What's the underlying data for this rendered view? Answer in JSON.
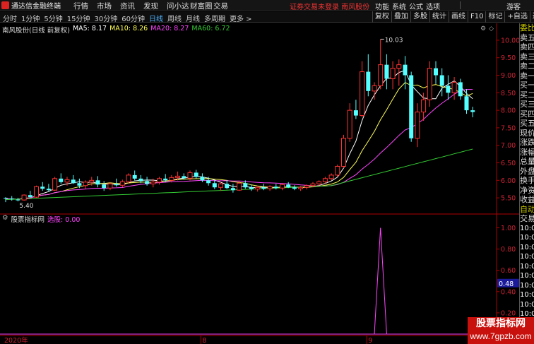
{
  "menubar": {
    "app_title": "通达信金融终端",
    "items": [
      "行情",
      "市场",
      "资讯",
      "发现",
      "问小达",
      "财富圈",
      "交易"
    ],
    "notice": "证券交易未登录  南风股份",
    "right_items": [
      "功能",
      "系统",
      "公式",
      "选项"
    ],
    "guest": "游客"
  },
  "toolbar": {
    "periods": [
      "分时",
      "1分钟",
      "5分钟",
      "15分钟",
      "30分钟",
      "60分钟",
      "日线",
      "周线",
      "月线",
      "多周期",
      "更多 >"
    ],
    "active_period": "日线",
    "tools": [
      "复权",
      "叠加",
      "多股",
      "统计",
      "画线",
      "F10",
      "标记",
      "+自选",
      "返回"
    ]
  },
  "main_panel": {
    "stock_title": "南风股份(日线 前复权)",
    "ma5": "MA5: 8.17",
    "ma10": "MA10: 8.26",
    "ma20": "MA20: 8.27",
    "ma60": "MA60: 6.72",
    "high_label": "10.03",
    "low_label": "5.40"
  },
  "sub_panel": {
    "title": "股票指标网",
    "value_label": "选股: 0.00",
    "cursor_value": "0.48"
  },
  "x_axis": {
    "labels": [
      "2020年",
      "8",
      "9"
    ]
  },
  "colors": {
    "up": "#ff3333",
    "down": "#54ffff",
    "ma5": "#ffffff",
    "ma10": "#ffff55",
    "ma20": "#ff44ff",
    "ma60": "#33cc33",
    "indicator": "#ff44ff",
    "axis": "#b00000",
    "grid": "#4a0000"
  },
  "chart_data": [
    {
      "type": "candlestick",
      "title": "南风股份(日线 前复权)",
      "ylim": [
        5.2,
        10.2
      ],
      "yticks": [
        5.5,
        6.0,
        6.5,
        7.0,
        7.5,
        8.0,
        8.5,
        9.0,
        9.5,
        10.0
      ],
      "ytick_labels": [
        "5.50",
        "6.00",
        "6.50",
        "7.00",
        "7.50",
        "8.00",
        "8.50",
        "9.00",
        "9.50",
        "10.00"
      ],
      "candles": [
        [
          5.5,
          5.52,
          5.38,
          5.48
        ],
        [
          5.48,
          5.55,
          5.42,
          5.46
        ],
        [
          5.45,
          5.5,
          5.4,
          5.44
        ],
        [
          5.44,
          5.6,
          5.42,
          5.58
        ],
        [
          5.58,
          5.7,
          5.5,
          5.52
        ],
        [
          5.52,
          5.85,
          5.5,
          5.82
        ],
        [
          5.82,
          5.95,
          5.7,
          5.76
        ],
        [
          5.76,
          5.9,
          5.68,
          5.72
        ],
        [
          5.72,
          6.1,
          5.7,
          6.05
        ],
        [
          6.05,
          6.2,
          5.9,
          5.95
        ],
        [
          5.95,
          6.1,
          5.85,
          6.02
        ],
        [
          6.02,
          6.15,
          5.9,
          5.92
        ],
        [
          5.92,
          6.05,
          5.78,
          5.85
        ],
        [
          5.85,
          6.0,
          5.75,
          5.95
        ],
        [
          5.95,
          6.1,
          5.85,
          6.0
        ],
        [
          6.0,
          6.12,
          5.8,
          5.88
        ],
        [
          5.88,
          5.98,
          5.7,
          5.78
        ],
        [
          5.78,
          5.95,
          5.72,
          5.9
        ],
        [
          5.9,
          6.05,
          5.82,
          5.86
        ],
        [
          5.86,
          6.02,
          5.8,
          5.96
        ],
        [
          5.96,
          6.2,
          5.9,
          6.15
        ],
        [
          6.15,
          6.28,
          6.0,
          6.05
        ],
        [
          6.05,
          6.15,
          5.92,
          5.98
        ],
        [
          5.98,
          6.1,
          5.85,
          5.9
        ],
        [
          5.9,
          6.05,
          5.8,
          5.95
        ],
        [
          5.95,
          6.1,
          5.88,
          6.05
        ],
        [
          6.05,
          6.18,
          5.95,
          6.0
        ],
        [
          6.0,
          6.15,
          5.94,
          6.08
        ],
        [
          6.08,
          6.25,
          6.0,
          6.12
        ],
        [
          6.12,
          6.2,
          6.02,
          6.06
        ],
        [
          6.06,
          6.28,
          6.0,
          6.22
        ],
        [
          6.22,
          6.3,
          6.05,
          6.1
        ],
        [
          6.1,
          6.2,
          5.95,
          6.0
        ],
        [
          6.0,
          6.1,
          5.85,
          5.92
        ],
        [
          5.92,
          6.0,
          5.75,
          5.8
        ],
        [
          5.8,
          5.95,
          5.7,
          5.9
        ],
        [
          5.9,
          6.0,
          5.75,
          5.78
        ],
        [
          5.78,
          5.9,
          5.65,
          5.72
        ],
        [
          5.72,
          5.98,
          5.7,
          5.92
        ],
        [
          5.92,
          6.0,
          5.76,
          5.8
        ],
        [
          5.8,
          5.88,
          5.7,
          5.75
        ],
        [
          5.75,
          5.85,
          5.68,
          5.8
        ],
        [
          5.8,
          5.9,
          5.72,
          5.76
        ],
        [
          5.76,
          5.86,
          5.7,
          5.82
        ],
        [
          5.82,
          5.9,
          5.74,
          5.78
        ],
        [
          5.78,
          5.92,
          5.72,
          5.88
        ],
        [
          5.88,
          5.95,
          5.78,
          5.8
        ],
        [
          5.8,
          5.86,
          5.72,
          5.76
        ],
        [
          5.76,
          5.84,
          5.7,
          5.8
        ],
        [
          5.8,
          5.88,
          5.74,
          5.85
        ],
        [
          5.85,
          5.95,
          5.8,
          5.9
        ],
        [
          5.9,
          6.0,
          5.84,
          5.96
        ],
        [
          5.96,
          6.1,
          5.9,
          6.05
        ],
        [
          6.05,
          6.2,
          6.0,
          6.15
        ],
        [
          6.15,
          6.45,
          6.1,
          6.4
        ],
        [
          6.4,
          7.3,
          6.35,
          7.2
        ],
        [
          7.2,
          8.2,
          7.1,
          8.0
        ],
        [
          8.0,
          8.3,
          7.75,
          7.85
        ],
        [
          7.85,
          9.4,
          7.8,
          9.1
        ],
        [
          9.1,
          9.6,
          8.4,
          8.55
        ],
        [
          8.55,
          8.8,
          8.3,
          8.7
        ],
        [
          8.7,
          10.03,
          8.6,
          9.3
        ],
        [
          9.3,
          9.6,
          8.6,
          8.9
        ],
        [
          8.9,
          9.4,
          8.6,
          9.2
        ],
        [
          9.2,
          9.45,
          8.7,
          9.3
        ],
        [
          9.3,
          9.55,
          8.6,
          9.0
        ],
        [
          9.0,
          9.1,
          7.1,
          7.2
        ],
        [
          7.2,
          8.2,
          6.95,
          7.95
        ],
        [
          7.95,
          8.5,
          7.7,
          8.3
        ],
        [
          8.3,
          9.4,
          8.1,
          9.2
        ],
        [
          9.2,
          9.4,
          8.75,
          9.0
        ],
        [
          9.0,
          9.2,
          8.4,
          8.7
        ],
        [
          8.7,
          9.0,
          8.3,
          8.5
        ],
        [
          8.5,
          8.95,
          8.3,
          8.8
        ],
        [
          8.8,
          8.9,
          8.3,
          8.4
        ],
        [
          8.4,
          8.6,
          7.9,
          8.0
        ],
        [
          8.0,
          8.1,
          7.8,
          7.95
        ]
      ],
      "series": [
        {
          "name": "MA5",
          "last": 8.17
        },
        {
          "name": "MA10",
          "last": 8.26
        },
        {
          "name": "MA20",
          "last": 8.27
        },
        {
          "name": "MA60",
          "last": 6.72
        }
      ],
      "annotations": [
        {
          "text": "10.03"
        },
        {
          "text": "5.40"
        }
      ]
    },
    {
      "type": "line",
      "title": "股票指标网",
      "ylim": [
        0,
        1.05
      ],
      "yticks": [
        0.2,
        0.4,
        0.6,
        0.8,
        1.0
      ],
      "ytick_labels": [
        "0.20",
        "0.40",
        "0.60",
        "0.80",
        "1.00"
      ],
      "values_index": [
        60,
        61,
        62
      ],
      "values": [
        0,
        1,
        0
      ],
      "baseline": 0
    }
  ]
}
